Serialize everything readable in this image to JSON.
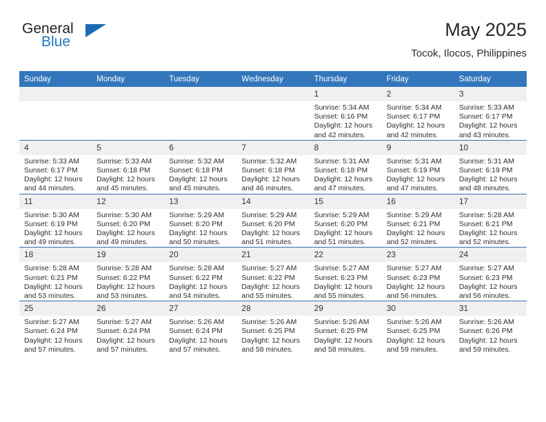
{
  "brand": {
    "word_one": "General",
    "word_two": "Blue",
    "accent_color": "#2077bd",
    "triangle_color": "#1a6cb5"
  },
  "header": {
    "title": "May 2025",
    "subtitle": "Tocok, Ilocos, Philippines"
  },
  "theme": {
    "header_row_bg": "#3376bb",
    "header_row_text": "#ffffff",
    "daynum_bg": "#f0f0f0",
    "row_border": "#2f6fb0"
  },
  "weekday_headers": [
    "Sunday",
    "Monday",
    "Tuesday",
    "Wednesday",
    "Thursday",
    "Friday",
    "Saturday"
  ],
  "weeks": [
    [
      {
        "day": "",
        "empty": true,
        "sunrise": "",
        "sunset": "",
        "daylight_1": "",
        "daylight_2": ""
      },
      {
        "day": "",
        "empty": true,
        "sunrise": "",
        "sunset": "",
        "daylight_1": "",
        "daylight_2": ""
      },
      {
        "day": "",
        "empty": true,
        "sunrise": "",
        "sunset": "",
        "daylight_1": "",
        "daylight_2": ""
      },
      {
        "day": "",
        "empty": true,
        "sunrise": "",
        "sunset": "",
        "daylight_1": "",
        "daylight_2": ""
      },
      {
        "day": "1",
        "empty": false,
        "sunrise": "Sunrise: 5:34 AM",
        "sunset": "Sunset: 6:16 PM",
        "daylight_1": "Daylight: 12 hours",
        "daylight_2": "and 42 minutes."
      },
      {
        "day": "2",
        "empty": false,
        "sunrise": "Sunrise: 5:34 AM",
        "sunset": "Sunset: 6:17 PM",
        "daylight_1": "Daylight: 12 hours",
        "daylight_2": "and 42 minutes."
      },
      {
        "day": "3",
        "empty": false,
        "sunrise": "Sunrise: 5:33 AM",
        "sunset": "Sunset: 6:17 PM",
        "daylight_1": "Daylight: 12 hours",
        "daylight_2": "and 43 minutes."
      }
    ],
    [
      {
        "day": "4",
        "empty": false,
        "sunrise": "Sunrise: 5:33 AM",
        "sunset": "Sunset: 6:17 PM",
        "daylight_1": "Daylight: 12 hours",
        "daylight_2": "and 44 minutes."
      },
      {
        "day": "5",
        "empty": false,
        "sunrise": "Sunrise: 5:33 AM",
        "sunset": "Sunset: 6:18 PM",
        "daylight_1": "Daylight: 12 hours",
        "daylight_2": "and 45 minutes."
      },
      {
        "day": "6",
        "empty": false,
        "sunrise": "Sunrise: 5:32 AM",
        "sunset": "Sunset: 6:18 PM",
        "daylight_1": "Daylight: 12 hours",
        "daylight_2": "and 45 minutes."
      },
      {
        "day": "7",
        "empty": false,
        "sunrise": "Sunrise: 5:32 AM",
        "sunset": "Sunset: 6:18 PM",
        "daylight_1": "Daylight: 12 hours",
        "daylight_2": "and 46 minutes."
      },
      {
        "day": "8",
        "empty": false,
        "sunrise": "Sunrise: 5:31 AM",
        "sunset": "Sunset: 6:18 PM",
        "daylight_1": "Daylight: 12 hours",
        "daylight_2": "and 47 minutes."
      },
      {
        "day": "9",
        "empty": false,
        "sunrise": "Sunrise: 5:31 AM",
        "sunset": "Sunset: 6:19 PM",
        "daylight_1": "Daylight: 12 hours",
        "daylight_2": "and 47 minutes."
      },
      {
        "day": "10",
        "empty": false,
        "sunrise": "Sunrise: 5:31 AM",
        "sunset": "Sunset: 6:19 PM",
        "daylight_1": "Daylight: 12 hours",
        "daylight_2": "and 48 minutes."
      }
    ],
    [
      {
        "day": "11",
        "empty": false,
        "sunrise": "Sunrise: 5:30 AM",
        "sunset": "Sunset: 6:19 PM",
        "daylight_1": "Daylight: 12 hours",
        "daylight_2": "and 49 minutes."
      },
      {
        "day": "12",
        "empty": false,
        "sunrise": "Sunrise: 5:30 AM",
        "sunset": "Sunset: 6:20 PM",
        "daylight_1": "Daylight: 12 hours",
        "daylight_2": "and 49 minutes."
      },
      {
        "day": "13",
        "empty": false,
        "sunrise": "Sunrise: 5:29 AM",
        "sunset": "Sunset: 6:20 PM",
        "daylight_1": "Daylight: 12 hours",
        "daylight_2": "and 50 minutes."
      },
      {
        "day": "14",
        "empty": false,
        "sunrise": "Sunrise: 5:29 AM",
        "sunset": "Sunset: 6:20 PM",
        "daylight_1": "Daylight: 12 hours",
        "daylight_2": "and 51 minutes."
      },
      {
        "day": "15",
        "empty": false,
        "sunrise": "Sunrise: 5:29 AM",
        "sunset": "Sunset: 6:20 PM",
        "daylight_1": "Daylight: 12 hours",
        "daylight_2": "and 51 minutes."
      },
      {
        "day": "16",
        "empty": false,
        "sunrise": "Sunrise: 5:29 AM",
        "sunset": "Sunset: 6:21 PM",
        "daylight_1": "Daylight: 12 hours",
        "daylight_2": "and 52 minutes."
      },
      {
        "day": "17",
        "empty": false,
        "sunrise": "Sunrise: 5:28 AM",
        "sunset": "Sunset: 6:21 PM",
        "daylight_1": "Daylight: 12 hours",
        "daylight_2": "and 52 minutes."
      }
    ],
    [
      {
        "day": "18",
        "empty": false,
        "sunrise": "Sunrise: 5:28 AM",
        "sunset": "Sunset: 6:21 PM",
        "daylight_1": "Daylight: 12 hours",
        "daylight_2": "and 53 minutes."
      },
      {
        "day": "19",
        "empty": false,
        "sunrise": "Sunrise: 5:28 AM",
        "sunset": "Sunset: 6:22 PM",
        "daylight_1": "Daylight: 12 hours",
        "daylight_2": "and 53 minutes."
      },
      {
        "day": "20",
        "empty": false,
        "sunrise": "Sunrise: 5:28 AM",
        "sunset": "Sunset: 6:22 PM",
        "daylight_1": "Daylight: 12 hours",
        "daylight_2": "and 54 minutes."
      },
      {
        "day": "21",
        "empty": false,
        "sunrise": "Sunrise: 5:27 AM",
        "sunset": "Sunset: 6:22 PM",
        "daylight_1": "Daylight: 12 hours",
        "daylight_2": "and 55 minutes."
      },
      {
        "day": "22",
        "empty": false,
        "sunrise": "Sunrise: 5:27 AM",
        "sunset": "Sunset: 6:23 PM",
        "daylight_1": "Daylight: 12 hours",
        "daylight_2": "and 55 minutes."
      },
      {
        "day": "23",
        "empty": false,
        "sunrise": "Sunrise: 5:27 AM",
        "sunset": "Sunset: 6:23 PM",
        "daylight_1": "Daylight: 12 hours",
        "daylight_2": "and 56 minutes."
      },
      {
        "day": "24",
        "empty": false,
        "sunrise": "Sunrise: 5:27 AM",
        "sunset": "Sunset: 6:23 PM",
        "daylight_1": "Daylight: 12 hours",
        "daylight_2": "and 56 minutes."
      }
    ],
    [
      {
        "day": "25",
        "empty": false,
        "sunrise": "Sunrise: 5:27 AM",
        "sunset": "Sunset: 6:24 PM",
        "daylight_1": "Daylight: 12 hours",
        "daylight_2": "and 57 minutes."
      },
      {
        "day": "26",
        "empty": false,
        "sunrise": "Sunrise: 5:27 AM",
        "sunset": "Sunset: 6:24 PM",
        "daylight_1": "Daylight: 12 hours",
        "daylight_2": "and 57 minutes."
      },
      {
        "day": "27",
        "empty": false,
        "sunrise": "Sunrise: 5:26 AM",
        "sunset": "Sunset: 6:24 PM",
        "daylight_1": "Daylight: 12 hours",
        "daylight_2": "and 57 minutes."
      },
      {
        "day": "28",
        "empty": false,
        "sunrise": "Sunrise: 5:26 AM",
        "sunset": "Sunset: 6:25 PM",
        "daylight_1": "Daylight: 12 hours",
        "daylight_2": "and 58 minutes."
      },
      {
        "day": "29",
        "empty": false,
        "sunrise": "Sunrise: 5:26 AM",
        "sunset": "Sunset: 6:25 PM",
        "daylight_1": "Daylight: 12 hours",
        "daylight_2": "and 58 minutes."
      },
      {
        "day": "30",
        "empty": false,
        "sunrise": "Sunrise: 5:26 AM",
        "sunset": "Sunset: 6:25 PM",
        "daylight_1": "Daylight: 12 hours",
        "daylight_2": "and 59 minutes."
      },
      {
        "day": "31",
        "empty": false,
        "sunrise": "Sunrise: 5:26 AM",
        "sunset": "Sunset: 6:26 PM",
        "daylight_1": "Daylight: 12 hours",
        "daylight_2": "and 59 minutes."
      }
    ]
  ]
}
